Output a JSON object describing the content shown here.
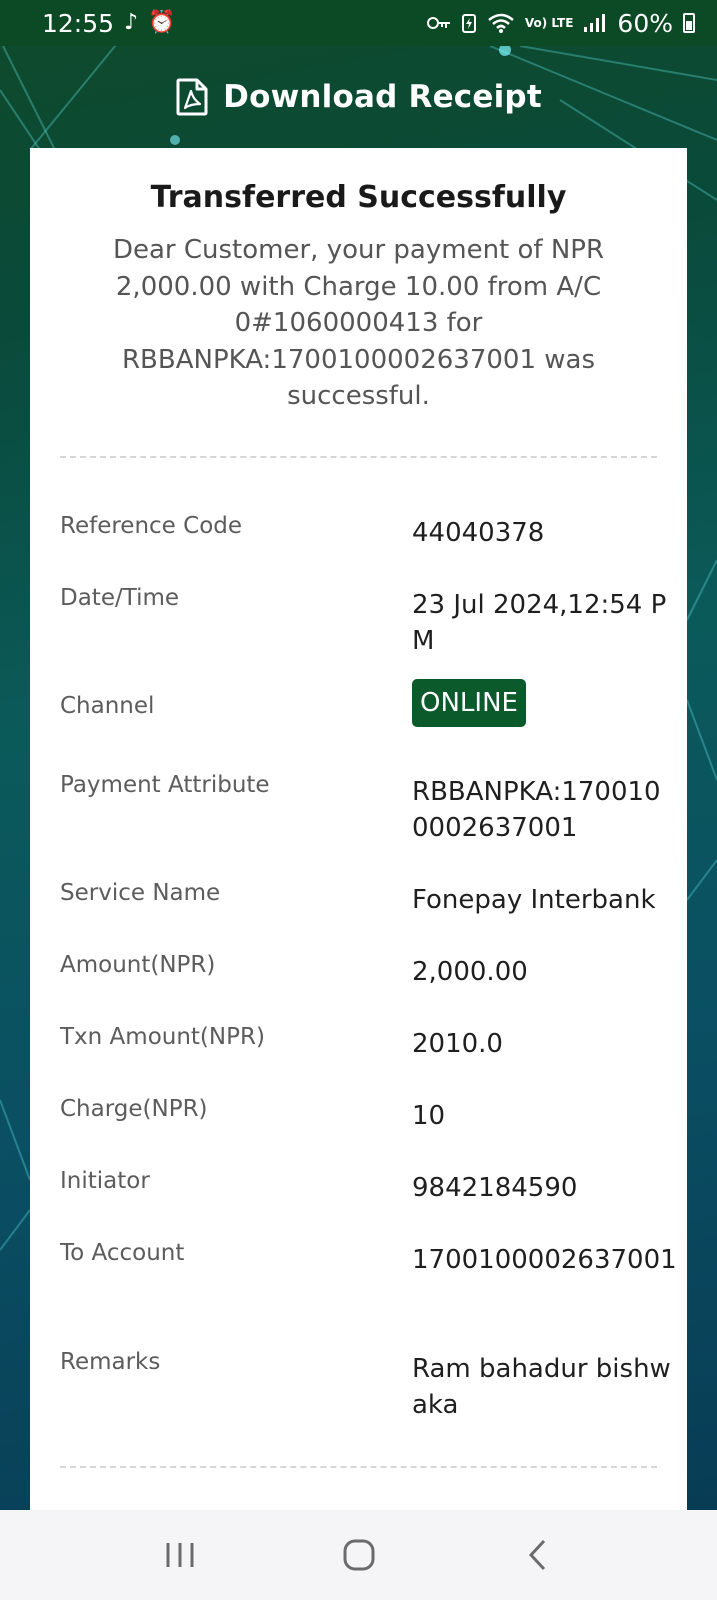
{
  "status_bar": {
    "time": "12:55",
    "battery": "60%",
    "network_label": "Vo) LTE"
  },
  "header": {
    "title": "Download Receipt",
    "icon": "pdf-file-icon"
  },
  "receipt": {
    "title": "Transferred Successfully",
    "message": "Dear Customer, your payment of NPR 2,000.00 with Charge 10.00 from A/C 0#1060000413 for RBBANPKA:1700100002637001 was successful.",
    "rows": [
      {
        "label": "Reference Code",
        "value": "44040378"
      },
      {
        "label": "Date/Time",
        "value": "23 Jul 2024,12:54 PM"
      },
      {
        "label": "Channel",
        "value": "ONLINE"
      },
      {
        "label": "Payment Attribute",
        "value": "RBBANPKA:1700100002637001"
      },
      {
        "label": "Service Name",
        "value": "Fonepay Interbank"
      },
      {
        "label": "Amount(NPR)",
        "value": "2,000.00"
      },
      {
        "label": "Txn Amount(NPR)",
        "value": "2010.0"
      },
      {
        "label": "Charge(NPR)",
        "value": "10"
      },
      {
        "label": "Initiator",
        "value": "9842184590"
      },
      {
        "label": "To Account",
        "value": "1700100002637001"
      },
      {
        "label": "Remarks",
        "value": "Ram bahadur bishwaka"
      }
    ]
  },
  "colors": {
    "brand_green": "#0b5a2c",
    "status_bar": "#0b4a25"
  }
}
